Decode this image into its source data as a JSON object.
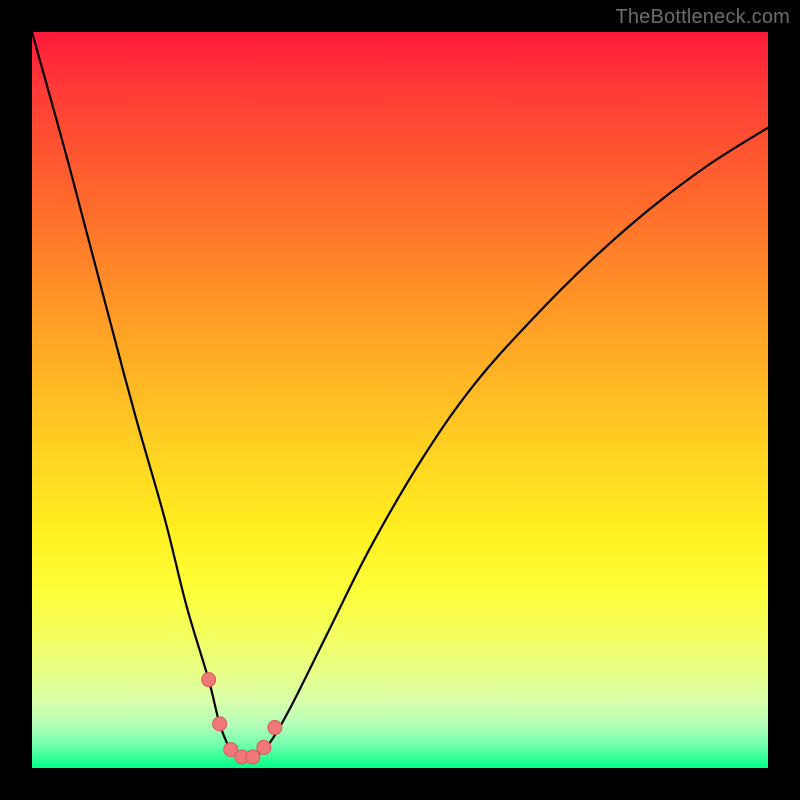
{
  "watermark": "TheBottleneck.com",
  "colors": {
    "background": "#000000",
    "curve": "#000000",
    "marker_fill": "#f07878",
    "marker_stroke": "#d85a5a"
  },
  "chart_data": {
    "type": "line",
    "title": "",
    "xlabel": "",
    "ylabel": "",
    "xlim": [
      0,
      100
    ],
    "ylim": [
      0,
      100
    ],
    "series": [
      {
        "name": "bottleneck-curve",
        "x": [
          0,
          5,
          10,
          14,
          18,
          21,
          24,
          25.5,
          27,
          28.5,
          30,
          32,
          35,
          40,
          46,
          53,
          60,
          68,
          76,
          84,
          92,
          100
        ],
        "values": [
          100,
          82,
          63,
          48,
          34,
          22,
          12,
          6,
          2.5,
          1.5,
          1.5,
          3,
          8,
          18,
          30,
          42,
          52,
          61,
          69,
          76,
          82,
          87
        ]
      }
    ],
    "markers": {
      "name": "highlight-points",
      "x": [
        24,
        25.5,
        27,
        28.5,
        30,
        31.5,
        33
      ],
      "values": [
        12,
        6,
        2.5,
        1.5,
        1.5,
        2.8,
        5.5
      ]
    }
  }
}
